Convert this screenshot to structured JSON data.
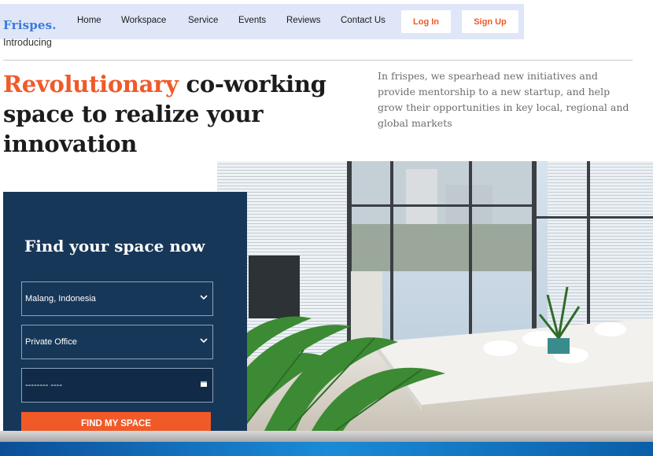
{
  "nav": {
    "logo": "Frispes.",
    "links": [
      "Home",
      "Workspace",
      "Service",
      "Events",
      "Reviews",
      "Contact Us"
    ],
    "login_label": "Log In",
    "signup_label": "Sign Up"
  },
  "hero": {
    "intro": "Introducing",
    "headline_accent": "Revolutionary",
    "headline_rest": " co-working space to realize your innovation",
    "description": "In frispes, we spearhead new initiatives and provide mentorship to a new startup, and help grow their opportunities in key local, regional and global markets"
  },
  "search": {
    "title": "Find your space now",
    "location_value": "Malang, Indonesia",
    "type_value": "Private Office",
    "date_placeholder": "-------- ----",
    "cta_label": "FIND MY SPACE"
  },
  "colors": {
    "accent": "#f05a28",
    "brand_blue": "#3a78e0",
    "panel_navy": "#173759",
    "nav_bg": "#dfe6f7"
  }
}
